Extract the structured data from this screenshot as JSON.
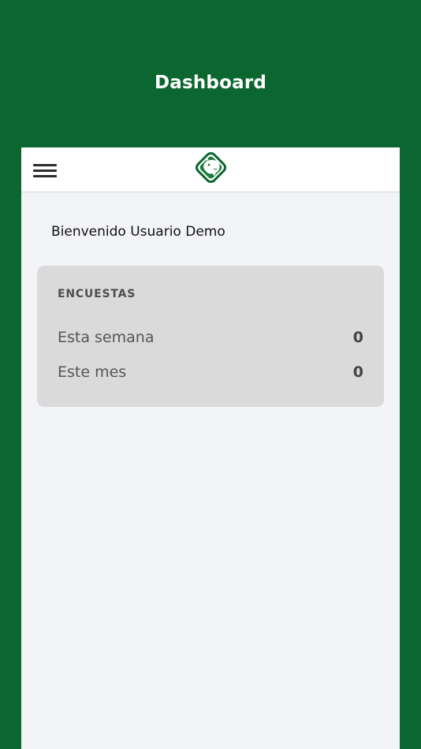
{
  "header": {
    "title": "Dashboard"
  },
  "navbar": {
    "menu_icon": "hamburger-menu-icon",
    "logo_icon": "puma-head-shield-logo"
  },
  "main": {
    "welcome_text": "Bienvenido Usuario Demo",
    "survey_card": {
      "title": "ENCUESTAS",
      "rows": [
        {
          "label": "Esta semana",
          "value": "0"
        },
        {
          "label": "Este mes",
          "value": "0"
        }
      ]
    }
  },
  "colors": {
    "brand_green": "#0c6630",
    "content_background": "#f3f4f8",
    "card_background": "#dadada"
  }
}
